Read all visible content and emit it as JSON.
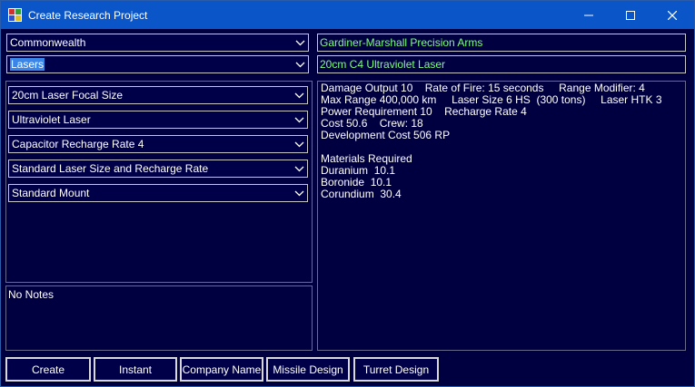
{
  "window": {
    "title": "Create Research Project"
  },
  "left": {
    "race_select": "Commonwealth",
    "category_select": "Lasers",
    "components": [
      "20cm Laser Focal Size",
      "Ultraviolet Laser",
      "Capacitor Recharge Rate 4",
      "Standard Laser Size and Recharge Rate",
      "Standard Mount"
    ],
    "notes": "No Notes"
  },
  "right": {
    "company_name": "Gardiner-Marshall Precision Arms",
    "project_name": "20cm C4 Ultraviolet Laser",
    "info_lines": [
      "Damage Output 10    Rate of Fire: 15 seconds     Range Modifier: 4",
      "Max Range 400,000 km     Laser Size 6 HS  (300 tons)     Laser HTK 3",
      "Power Requirement 10    Recharge Rate 4",
      "Cost 50.6    Crew: 18",
      "Development Cost 506 RP",
      "",
      "Materials Required",
      "Duranium  10.1",
      "Boronide  10.1",
      "Corundium  30.4"
    ]
  },
  "buttons": {
    "create": "Create",
    "instant": "Instant",
    "company_name": "Company Name",
    "missile_design": "Missile Design",
    "turret_design": "Turret Design"
  },
  "icons": {
    "app": "app-icon",
    "minimize": "minimize-icon",
    "maximize": "maximize-icon",
    "close": "close-icon",
    "dropdown": "chevron-down-icon"
  }
}
